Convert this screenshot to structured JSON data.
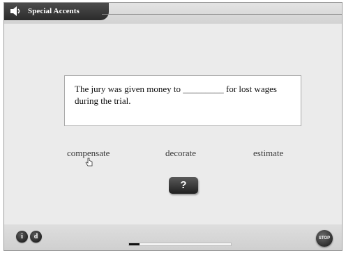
{
  "window": {
    "title": "Special Accents"
  },
  "prompt": {
    "sentence": "The jury was given money to _________ for lost wages during the trial."
  },
  "choices": [
    {
      "label": "compensate"
    },
    {
      "label": "decorate"
    },
    {
      "label": "estimate"
    }
  ],
  "help_button": {
    "label": "?"
  },
  "footer": {
    "info_label": "i",
    "d_label": "d",
    "stop_label": "STOP",
    "progress": 0.1
  },
  "icons": {
    "logo": "speaker-icon",
    "cursor": "hand-cursor-icon",
    "help": "help-icon",
    "stop": "stop-icon"
  }
}
